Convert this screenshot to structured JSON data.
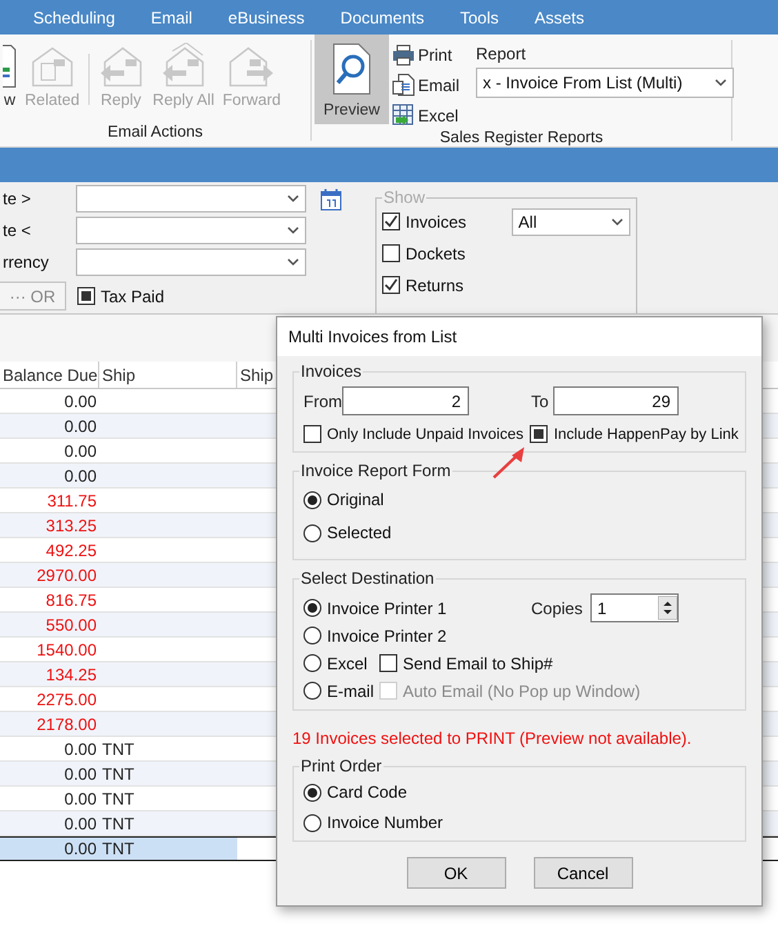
{
  "menu": [
    "Scheduling",
    "Email",
    "eBusiness",
    "Documents",
    "Tools",
    "Assets"
  ],
  "ribbon": {
    "groups": [
      {
        "label": "Email Actions",
        "sections": [
          {
            "buttons": [
              {
                "label": "w",
                "kind": "new",
                "disabled": false
              },
              {
                "label": "Related",
                "kind": "related",
                "disabled": true
              }
            ]
          },
          {
            "buttons": [
              {
                "label": "Reply",
                "kind": "reply",
                "disabled": true
              },
              {
                "label": "Reply All",
                "kind": "reply-all",
                "disabled": true
              },
              {
                "label": "Forward",
                "kind": "forward",
                "disabled": true
              }
            ]
          }
        ]
      },
      {
        "label": "Sales Register Reports",
        "preview": {
          "label": "Preview",
          "selected": true
        },
        "outputs": [
          {
            "label": "Print",
            "kind": "print"
          },
          {
            "label": "Email",
            "kind": "email"
          },
          {
            "label": "Excel",
            "kind": "excel"
          }
        ],
        "report": {
          "label": "Report",
          "value": "x - Invoice From List (Multi)"
        }
      }
    ]
  },
  "filters": [
    {
      "label": "te >",
      "calendar": true
    },
    {
      "label": "te <",
      "calendar": false
    },
    {
      "label": "rrency",
      "calendar": false
    }
  ],
  "or_button": {
    "dots": "···",
    "label": "OR"
  },
  "tax_paid": {
    "label": "Tax Paid",
    "checked": false,
    "indeterminate": true
  },
  "show": {
    "title": "Show",
    "items": [
      {
        "label": "Invoices",
        "checked": true,
        "select": "All"
      },
      {
        "label": "Dockets",
        "checked": false
      },
      {
        "label": "Returns",
        "checked": true
      }
    ]
  },
  "grid": {
    "columns": [
      "Balance Due",
      "Ship",
      "Ship"
    ],
    "rows": [
      {
        "balance": "0.00",
        "overdue": false,
        "selected": false
      },
      {
        "balance": "0.00",
        "overdue": false,
        "selected": false
      },
      {
        "balance": "0.00",
        "overdue": false,
        "selected": false
      },
      {
        "balance": "0.00",
        "overdue": false,
        "selected": false
      },
      {
        "balance": "311.75",
        "overdue": true,
        "selected": false
      },
      {
        "balance": "313.25",
        "overdue": true,
        "selected": false
      },
      {
        "balance": "492.25",
        "overdue": true,
        "selected": false
      },
      {
        "balance": "2970.00",
        "overdue": true,
        "selected": false
      },
      {
        "balance": "816.75",
        "overdue": true,
        "selected": false
      },
      {
        "balance": "550.00",
        "overdue": true,
        "selected": false
      },
      {
        "balance": "1540.00",
        "overdue": true,
        "selected": false
      },
      {
        "balance": "134.25",
        "overdue": true,
        "selected": false
      },
      {
        "balance": "2275.00",
        "overdue": true,
        "selected": false
      },
      {
        "balance": "2178.00",
        "overdue": true,
        "selected": false
      },
      {
        "balance": "0.00",
        "ship": "TNT",
        "overdue": false,
        "selected": false
      },
      {
        "balance": "0.00",
        "ship": "TNT",
        "overdue": false,
        "selected": false
      },
      {
        "balance": "0.00",
        "ship": "TNT",
        "overdue": false,
        "selected": false
      },
      {
        "balance": "0.00",
        "ship": "TNT",
        "overdue": false,
        "selected": false
      },
      {
        "balance": "0.00",
        "ship": "TNT",
        "overdue": false,
        "selected": true
      }
    ]
  },
  "dialog": {
    "title": "Multi Invoices from List",
    "invoices": {
      "title": "Invoices",
      "from_label": "From",
      "from": "2",
      "to_label": "To",
      "to": "29",
      "options": [
        {
          "label": "Only Include Unpaid Invoices",
          "checked": false,
          "indeterminate": false
        },
        {
          "label": "Include HappenPay by Link",
          "checked": false,
          "indeterminate": true
        }
      ]
    },
    "report_form": {
      "title": "Invoice Report Form",
      "options": [
        {
          "label": "Original",
          "selected": true
        },
        {
          "label": "Selected",
          "selected": false
        }
      ]
    },
    "destination": {
      "title": "Select Destination",
      "copies_label": "Copies",
      "copies": "1",
      "options": [
        {
          "label": "Invoice Printer 1",
          "selected": true
        },
        {
          "label": "Invoice Printer 2",
          "selected": false
        },
        {
          "label": "Excel",
          "selected": false,
          "extra": {
            "label": "Send Email to Ship#",
            "checked": false,
            "disabled": false
          }
        },
        {
          "label": "E-mail",
          "selected": false,
          "extra": {
            "label": "Auto Email (No Pop up Window)",
            "checked": false,
            "disabled": true
          }
        }
      ]
    },
    "message": "19 Invoices selected to PRINT (Preview not available).",
    "print_order": {
      "title": "Print Order",
      "options": [
        {
          "label": "Card Code",
          "selected": true
        },
        {
          "label": "Invoice Number",
          "selected": false
        }
      ]
    },
    "buttons": [
      "OK",
      "Cancel"
    ]
  }
}
